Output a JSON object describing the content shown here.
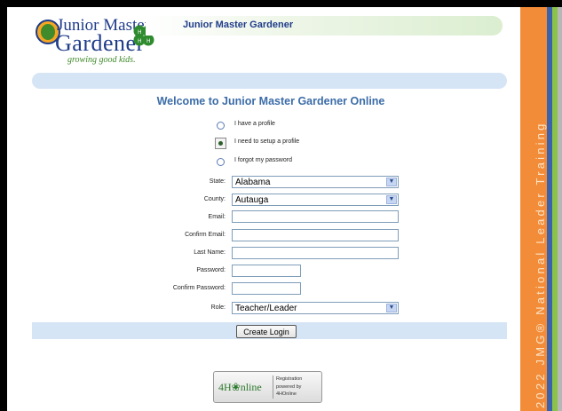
{
  "header": {
    "logo_line1": "Junior Master",
    "logo_line2": "Gardener",
    "logo_tagline": "growing good kids.",
    "title": "Junior Master Gardener"
  },
  "welcome_title": "Welcome to Junior Master Gardener Online",
  "profile_options": [
    {
      "label": "I have a profile",
      "selected": false
    },
    {
      "label": "I need to setup a profile",
      "selected": true
    },
    {
      "label": "I forgot my password",
      "selected": false
    }
  ],
  "form": {
    "state_label": "State:",
    "state_value": "Alabama",
    "county_label": "County:",
    "county_value": "Autauga",
    "email_label": "Email:",
    "email_value": "",
    "confirm_email_label": "Confirm Email:",
    "confirm_email_value": "",
    "last_name_label": "Last Name:",
    "last_name_value": "",
    "password_label": "Password:",
    "password_value": "",
    "confirm_password_label": "Confirm Password:",
    "confirm_password_value": "",
    "role_label": "Role:",
    "role_value": "Teacher/Leader"
  },
  "create_login_label": "Create Login",
  "badge": {
    "logo_text": "4H❀nline",
    "line1": "Registration",
    "line2": "powered by",
    "line3": "4HOnline"
  },
  "side_banner_text": "2022 JMG® National Leader Training",
  "colors": {
    "accent_blue": "#1f3c8a",
    "welcome_blue": "#3b6ca8",
    "bar_blue": "#d6e5f5",
    "side_orange": "#f28c38",
    "stripe_blue": "#3b63ad",
    "stripe_green": "#8bc34a"
  }
}
